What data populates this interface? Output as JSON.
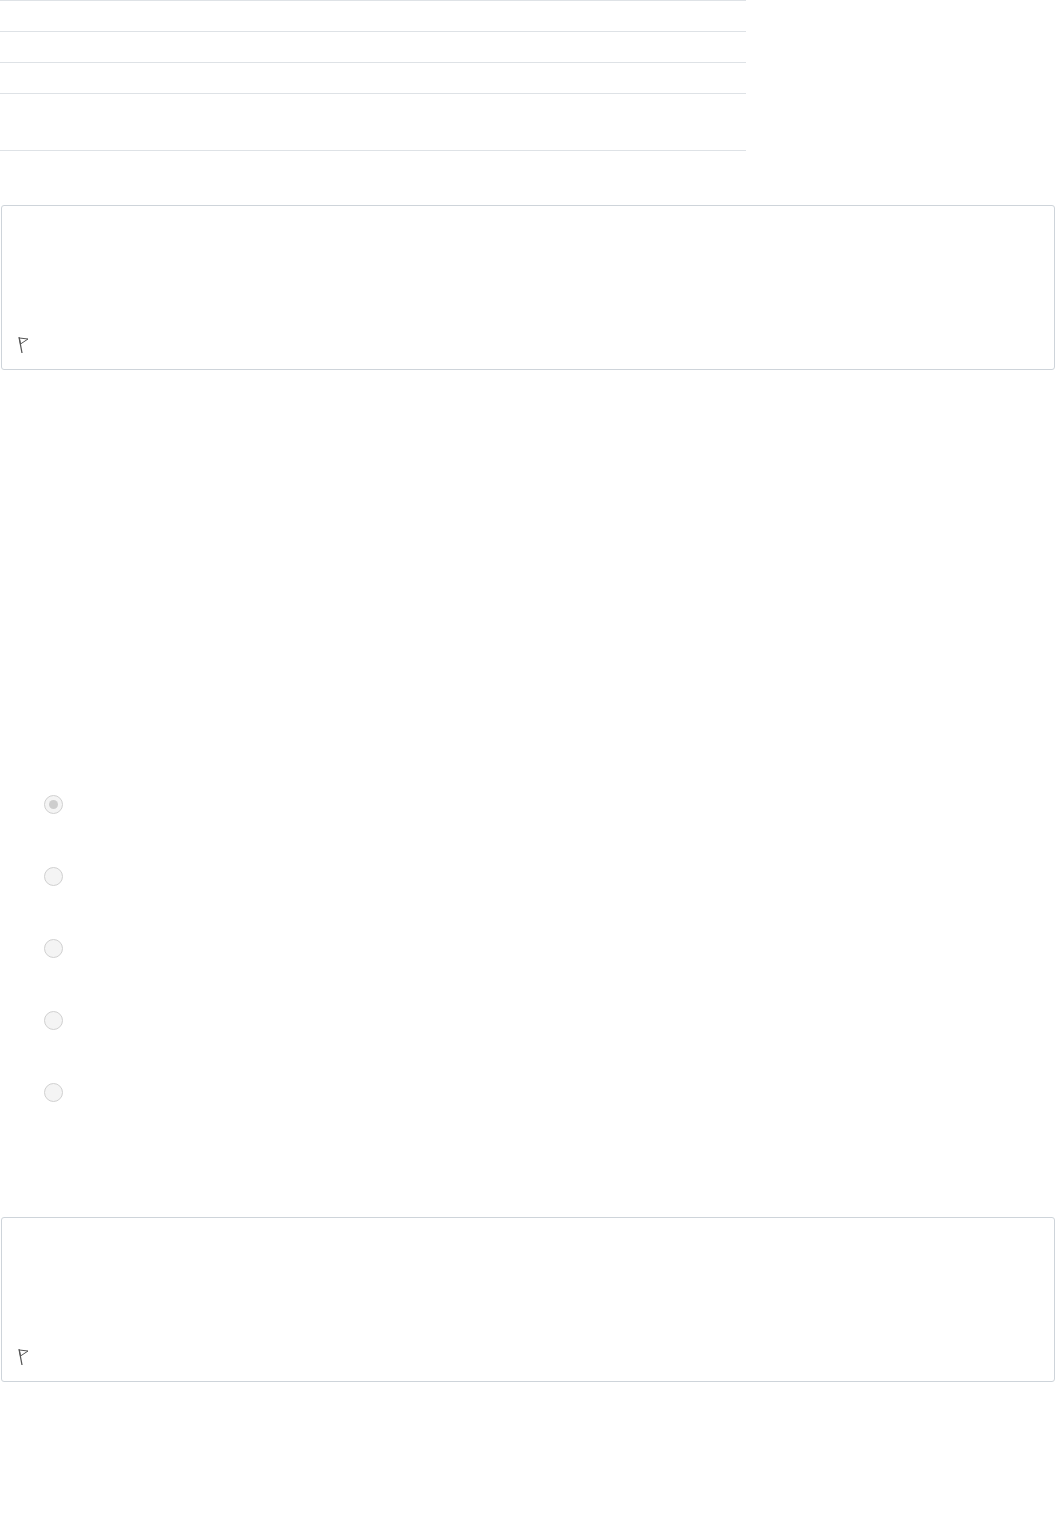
{
  "question_cards": [
    {
      "flagged": false
    },
    {
      "flagged": false
    }
  ],
  "options": [
    {
      "selected": true,
      "disabled": true
    },
    {
      "selected": false,
      "disabled": true
    },
    {
      "selected": false,
      "disabled": true
    },
    {
      "selected": false,
      "disabled": true
    },
    {
      "selected": false,
      "disabled": true
    }
  ]
}
